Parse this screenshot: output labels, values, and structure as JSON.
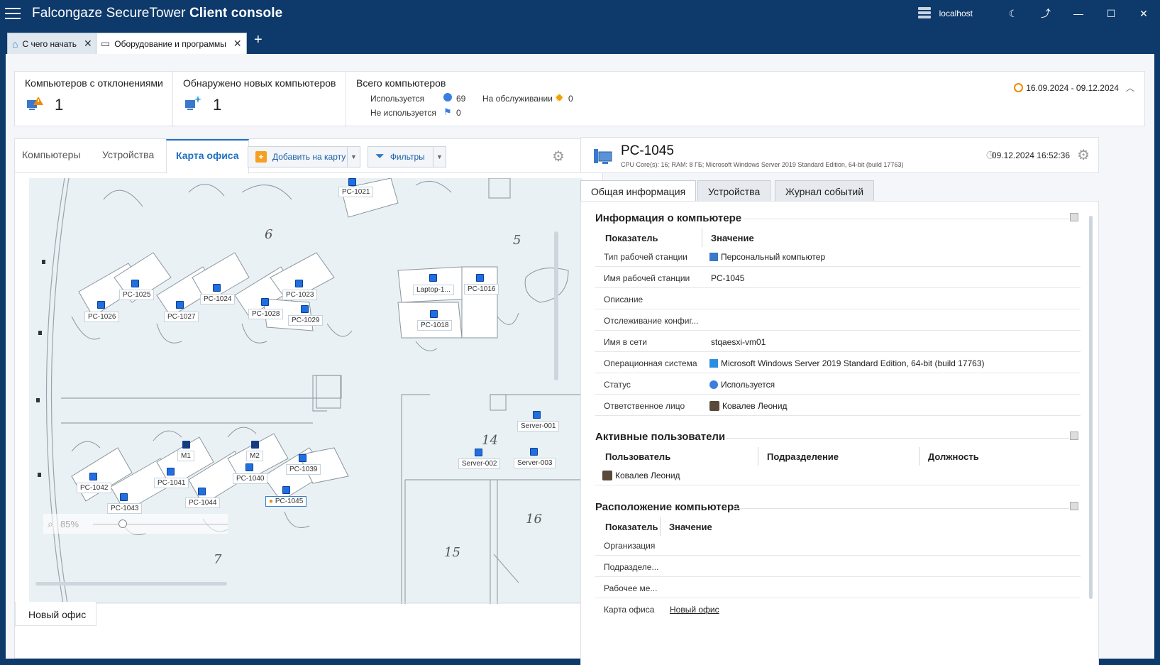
{
  "app": {
    "title_light": "Falcongaze SecureTower",
    "title_bold": "Client console",
    "host": "localhost"
  },
  "tabs": [
    {
      "label": "С чего начать"
    },
    {
      "label": "Оборудование и программы"
    }
  ],
  "summary": {
    "deviations_title": "Компьютеров с отклонениями",
    "deviations_value": "1",
    "new_title": "Обнаружено новых компьютеров",
    "new_value": "1",
    "total_title": "Всего компьютеров",
    "used_label": "Используется",
    "used_value": "69",
    "unused_label": "Не используется",
    "unused_value": "0",
    "service_label": "На обслуживании",
    "service_value": "0",
    "date_range": "16.09.2024 - 09.12.2024"
  },
  "left": {
    "tabs": [
      "Компьютеры",
      "Устройства",
      "Карта офиса"
    ],
    "add_button": "Добавить на карту",
    "filter_button": "Фильтры",
    "sheet_tab": "Новый офис",
    "zoom": "85%"
  },
  "map": {
    "room_numbers": [
      "6",
      "5",
      "14",
      "16",
      "15",
      "7"
    ],
    "pcs": [
      "PC-1021",
      "PC-1025",
      "PC-1024",
      "PC-1023",
      "Laptop-1...",
      "PC-1016",
      "PC-1026",
      "PC-1027",
      "PC-1028",
      "PC-1029",
      "PC-1018",
      "Server-001",
      "Server-002",
      "Server-003",
      "M1",
      "M2",
      "PC-1039",
      "PC-1040",
      "PC-1041",
      "PC-1042",
      "PC-1043",
      "PC-1044",
      "PC-1045"
    ]
  },
  "detail": {
    "name": "PC-1045",
    "subtitle": "CPU Core(s): 16; RAM: 8 ГБ; Microsoft Windows Server 2019 Standard Edition, 64-bit (build 17763)",
    "datetime": "09.12.2024 16:52:36",
    "tabs": [
      "Общая информация",
      "Устройства",
      "Журнал событий"
    ],
    "info_title": "Информация о компьютере",
    "col_param": "Показатель",
    "col_value": "Значение",
    "info_rows": [
      {
        "k": "Тип рабочей станции",
        "v": "Персональный компьютер"
      },
      {
        "k": "Имя рабочей станции",
        "v": "PC-1045"
      },
      {
        "k": "Описание",
        "v": ""
      },
      {
        "k": "Отслеживание конфиг...",
        "v": ""
      },
      {
        "k": "Имя в сети",
        "v": "stqaesxi-vm01"
      },
      {
        "k": "Операционная система",
        "v": "Microsoft Windows Server 2019 Standard Edition, 64-bit (build 17763)"
      },
      {
        "k": "Статус",
        "v": "Используется"
      },
      {
        "k": "Ответственное лицо",
        "v": "Ковалев Леонид"
      }
    ],
    "users_title": "Активные пользователи",
    "users_cols": [
      "Пользователь",
      "Подразделение",
      "Должность"
    ],
    "user_name": "Ковалев Леонид",
    "location_title": "Расположение компьютера",
    "location_rows": [
      {
        "k": "Организация",
        "v": ""
      },
      {
        "k": "Подразделе...",
        "v": ""
      },
      {
        "k": "Рабочее ме...",
        "v": ""
      },
      {
        "k": "Карта офиса",
        "v": "Новый офис"
      }
    ]
  }
}
